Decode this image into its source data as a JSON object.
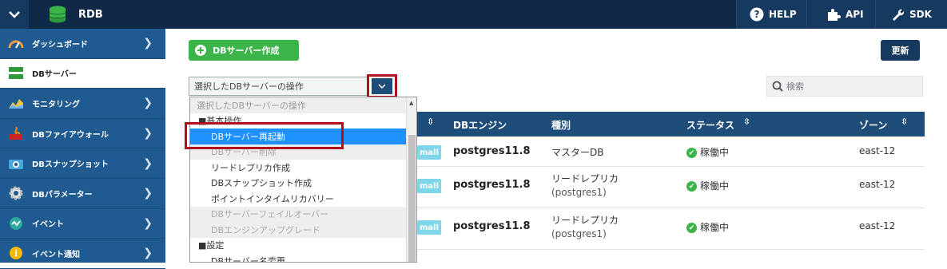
{
  "topbar": {
    "app_title": "RDB",
    "help_label": "HELP",
    "api_label": "API",
    "sdk_label": "SDK"
  },
  "sidebar": {
    "items": [
      {
        "label": "ダッシュボード",
        "icon": "gauge-icon"
      },
      {
        "label": "DBサーバー",
        "icon": "server-icon"
      },
      {
        "label": "モニタリング",
        "icon": "chart-icon"
      },
      {
        "label": "DBファイアウォール",
        "icon": "firewall-icon"
      },
      {
        "label": "DBスナップショット",
        "icon": "camera-icon"
      },
      {
        "label": "DBパラメーター",
        "icon": "gear-icon"
      },
      {
        "label": "イベント",
        "icon": "event-icon"
      },
      {
        "label": "イベント通知",
        "icon": "info-icon"
      }
    ]
  },
  "toolbar": {
    "create_label": "DBサーバー作成",
    "refresh_label": "更新",
    "operation_select_value": "選択したDBサーバーの操作",
    "search_placeholder": "検索"
  },
  "table": {
    "headers": {
      "engine": "DBエンジン",
      "type": "種別",
      "status": "ステータス",
      "zone": "ゾーン"
    },
    "rows": [
      {
        "badge": "mall",
        "engine": "postgres11.8",
        "type": "マスターDB",
        "type_sub": "",
        "status": "稼働中",
        "zone": "east-12"
      },
      {
        "badge": "mall",
        "engine": "postgres11.8",
        "type": "リードレプリカ",
        "type_sub": "(postgres1)",
        "status": "稼働中",
        "zone": "east-12"
      },
      {
        "badge": "mall",
        "engine": "postgres11.8",
        "type": "リードレプリカ",
        "type_sub": "(postgres1)",
        "status": "稼働中",
        "zone": "east-12"
      }
    ]
  },
  "dropdown": {
    "header": "選択したDBサーバーの操作",
    "group_basic": "■基本操作",
    "items_basic": [
      {
        "label": "DBサーバー再起動",
        "state": "selected"
      },
      {
        "label": "DBサーバー削除",
        "state": "disabled"
      },
      {
        "label": "リードレプリカ作成",
        "state": "normal"
      },
      {
        "label": "DBスナップショット作成",
        "state": "normal"
      },
      {
        "label": "ポイントインタイムリカバリー",
        "state": "normal"
      },
      {
        "label": "DBサーバーフェイルオーバー",
        "state": "disabled"
      },
      {
        "label": "DBエンジンアップグレード",
        "state": "disabled"
      }
    ],
    "group_settings": "■設定",
    "items_settings": [
      {
        "label": "DBサーバー名変更",
        "state": "normal"
      }
    ]
  },
  "colors": {
    "topbar": "#0f2946",
    "sidebar": "#1f5a91",
    "accent_green": "#3bb54a",
    "table_header": "#1f4d7a",
    "highlight_red": "#b0101e",
    "selected_option": "#1e90ff"
  }
}
